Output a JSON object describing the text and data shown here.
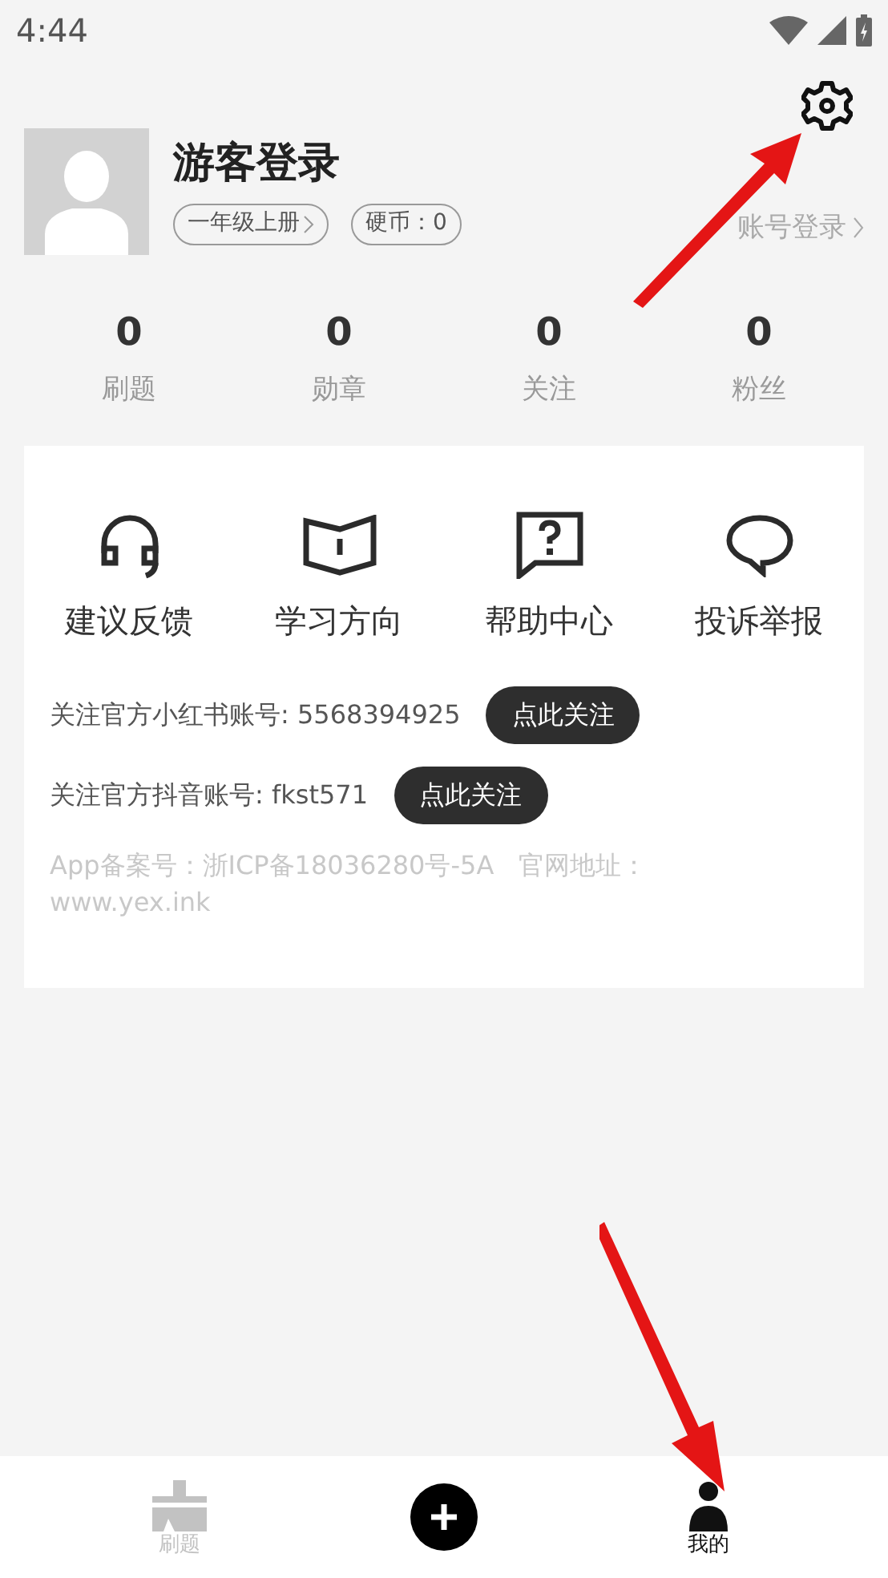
{
  "status_bar": {
    "time": "4:44"
  },
  "profile": {
    "name": "游客登录",
    "grade": "一年级上册",
    "coins": "硬币：0",
    "login_link": "账号登录"
  },
  "stats": [
    {
      "value": "0",
      "label": "刷题"
    },
    {
      "value": "0",
      "label": "勋章"
    },
    {
      "value": "0",
      "label": "关注"
    },
    {
      "value": "0",
      "label": "粉丝"
    }
  ],
  "shortcuts": [
    {
      "kind": "headset",
      "label": "建议反馈"
    },
    {
      "kind": "book",
      "label": "学习方向"
    },
    {
      "kind": "help",
      "label": "帮助中心"
    },
    {
      "kind": "chat",
      "label": "投诉举报"
    }
  ],
  "follow_rows": [
    {
      "text": "关注官方小红书账号: 5568394925",
      "button": "点此关注"
    },
    {
      "text": "关注官方抖音账号: fkst571",
      "button": "点此关注"
    }
  ],
  "footer": "App备案号：浙ICP备18036280号-5A   官网地址：www.yex.ink",
  "tabs": [
    {
      "kind": "practice",
      "label": "刷题",
      "selected": false
    },
    {
      "kind": "add"
    },
    {
      "kind": "me",
      "label": "我的",
      "selected": true
    }
  ]
}
